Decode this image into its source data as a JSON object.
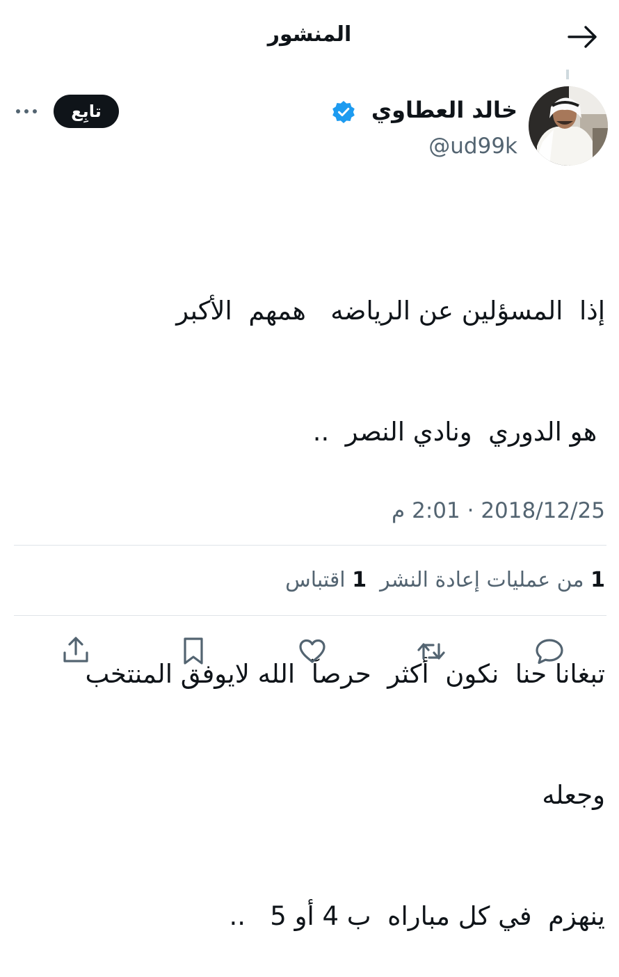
{
  "header": {
    "title": "المنشور",
    "back_icon": "arrow-right-icon"
  },
  "author": {
    "display_name": "خالد العطاوي",
    "handle": "@ud99k",
    "verified": true,
    "verified_color": "#1d9bf0",
    "avatar_icon": "profile-photo"
  },
  "follow_button": {
    "label": "تابِع"
  },
  "more_icon": "more-horizontal-icon",
  "tweet": {
    "lines": [
      "إذا  المسؤلين عن الرياضه   همهم  الأكبر",
      " هو الدوري  ونادي النصر  ..",
      "",
      "تبغانا حنا  نكون  أكثر  حرصآ  الله لايوفق المنتخب",
      "وجعله",
      "ينهزم  في كل مباراه  ب 4 أو 5   .."
    ]
  },
  "meta": {
    "time": "2:01 م",
    "separator": "·",
    "date": "2018/12/25"
  },
  "stats": {
    "reposts_count": "1",
    "reposts_label": "من عمليات إعادة النشر",
    "quotes_count": "1",
    "quotes_label": "اقتباس"
  },
  "actions": {
    "reply_icon": "reply-icon",
    "repost_icon": "repost-icon",
    "like_icon": "heart-icon",
    "bookmark_icon": "bookmark-icon",
    "share_icon": "share-icon"
  },
  "colors": {
    "text": "#0f1419",
    "secondary_text": "#536471",
    "divider": "#dfe4e8",
    "follow_button_bg": "#0f1419",
    "verified": "#1d9bf0"
  }
}
